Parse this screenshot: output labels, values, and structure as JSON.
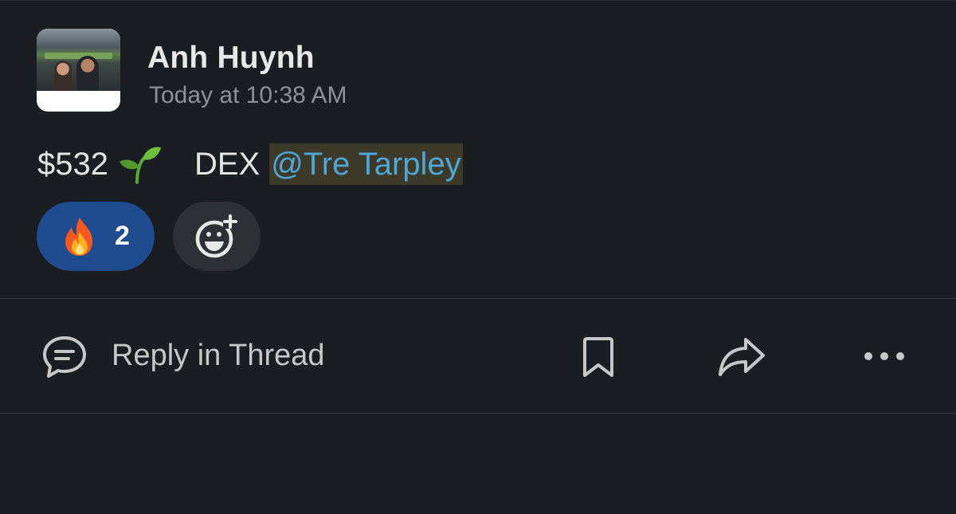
{
  "message": {
    "author": "Anh Huynh",
    "timestamp": "Today at 10:38 AM",
    "avatar_icon": "user-avatar-photo",
    "text_amount": "$532",
    "text_emoji": "seedling-emoji",
    "text_word": "DEX",
    "mention": "@Tre Tarpley"
  },
  "reactions": {
    "items": [
      {
        "emoji": "fire-emoji",
        "count": "2"
      }
    ],
    "add_icon": "add-reaction-icon"
  },
  "actions": {
    "reply_label": "Reply in Thread",
    "reply_icon": "thread-reply-icon",
    "bookmark_icon": "bookmark-icon",
    "share_icon": "share-icon",
    "more_icon": "more-icon"
  },
  "colors": {
    "background": "#1a1d21",
    "mention_text": "#4fa7d8",
    "mention_bg": "#3d3a2a",
    "reaction_active": "#1e4c8f",
    "reaction_neutral": "#2e3035"
  }
}
